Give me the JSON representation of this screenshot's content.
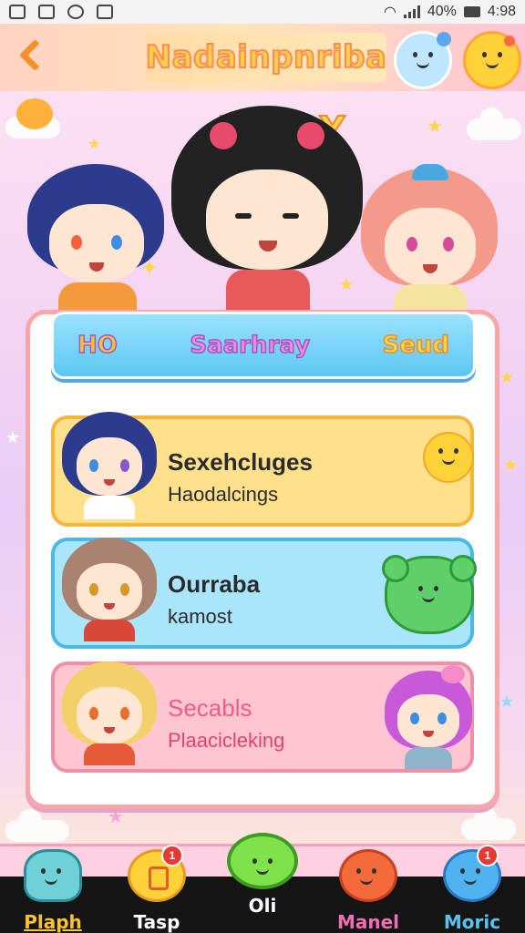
{
  "status_bar": {
    "battery": "40%",
    "time": "4:98"
  },
  "header": {
    "title": "Nadainpnriba"
  },
  "hero": {
    "title_letters": "TYTY"
  },
  "tabs": [
    {
      "label": "HO"
    },
    {
      "label": "Saarhray"
    },
    {
      "label": "Seud"
    }
  ],
  "cards": [
    {
      "title": "Sexehcluges",
      "subtitle": "Haodalcings"
    },
    {
      "title": "Ourraba",
      "subtitle": "kamost"
    },
    {
      "title": "Secabls",
      "subtitle": "Plaacicleking"
    }
  ],
  "bottom_nav": [
    {
      "label": "Plaph",
      "color": "#f7c52a",
      "badge": ""
    },
    {
      "label": "Tasp",
      "color": "#ffffff",
      "badge": "1"
    },
    {
      "label": "Oli",
      "color": "#ffffff",
      "badge": ""
    },
    {
      "label": "Manel",
      "color": "#f06fb0",
      "badge": ""
    },
    {
      "label": "Moric",
      "color": "#59c3f0",
      "badge": "1"
    }
  ],
  "header_badge": "",
  "colors": {
    "accent_orange": "#f5902a",
    "tab_blue": "#5cc7f2",
    "card_yellow": "#ffe18c",
    "card_blue": "#a9e6fb",
    "card_pink": "#ffc6d2"
  }
}
